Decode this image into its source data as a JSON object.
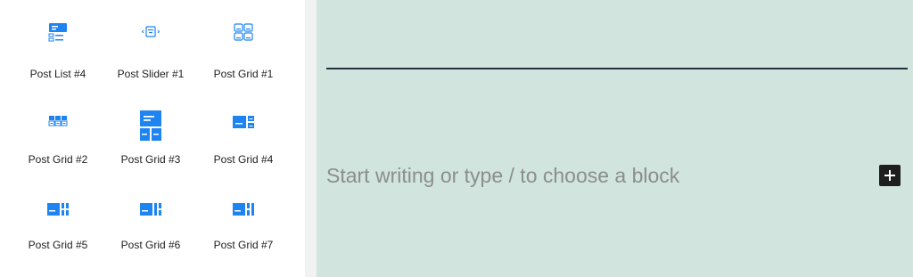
{
  "inserter": {
    "accent_color": "#1e84f2",
    "blocks": [
      {
        "label": "Post List #4",
        "icon": "post-list-icon"
      },
      {
        "label": "Post Slider #1",
        "icon": "post-slider-icon"
      },
      {
        "label": "Post Grid #1",
        "icon": "post-grid-outline-icon"
      },
      {
        "label": "Post Grid #2",
        "icon": "post-grid-tiles-icon"
      },
      {
        "label": "Post Grid #3",
        "icon": "post-grid-featured-icon"
      },
      {
        "label": "Post Grid #4",
        "icon": "post-grid-split-icon"
      },
      {
        "label": "Post Grid #5",
        "icon": "post-grid-columns-icon"
      },
      {
        "label": "Post Grid #6",
        "icon": "post-grid-columns-icon"
      },
      {
        "label": "Post Grid #7",
        "icon": "post-grid-columns-icon"
      }
    ]
  },
  "editor": {
    "background_color": "#d1e4dd",
    "placeholder": "Start writing or type / to choose a block",
    "add_block_icon": "plus-icon"
  }
}
